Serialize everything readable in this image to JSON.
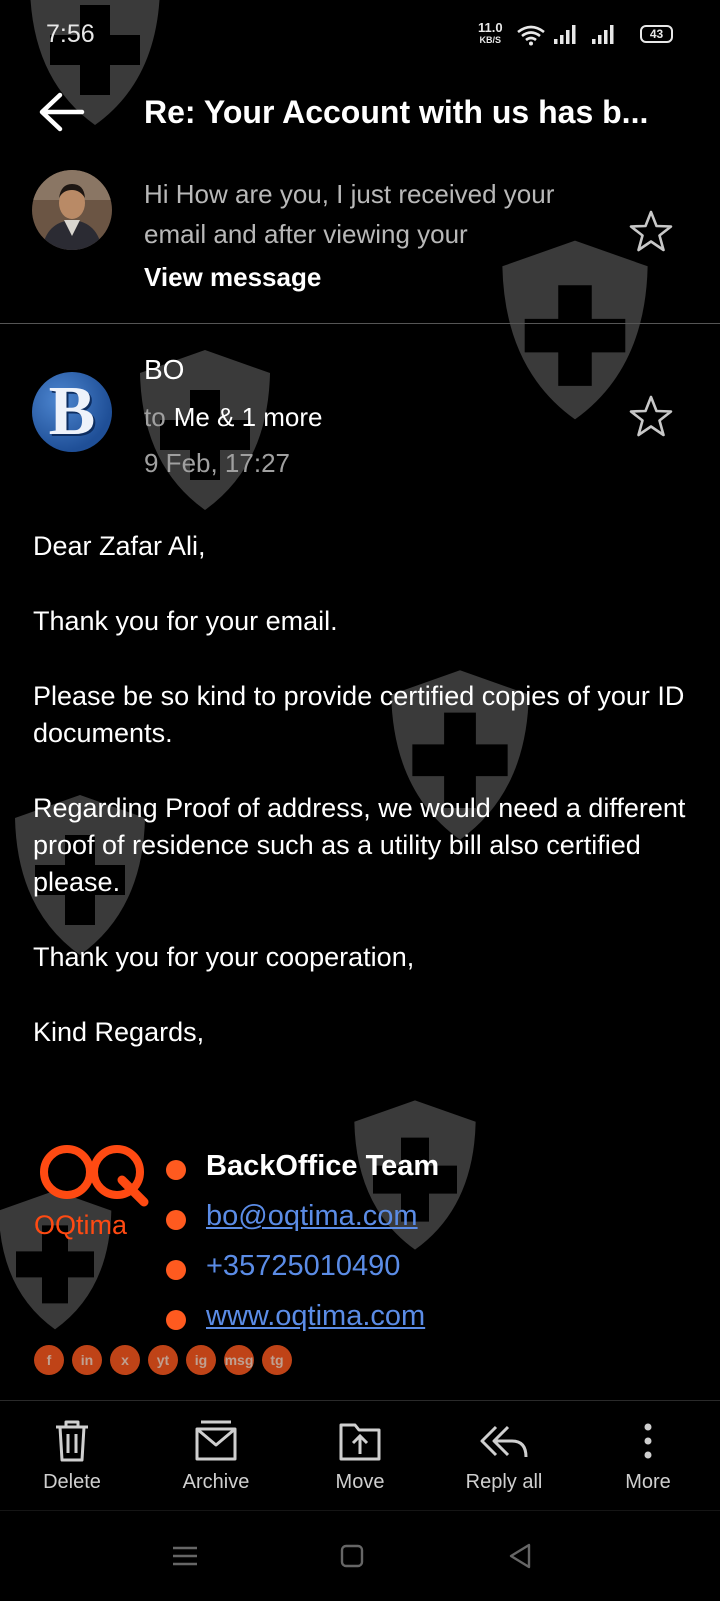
{
  "status_bar": {
    "time": "7:56",
    "net_speed_value": "11.0",
    "net_speed_unit": "KB/S",
    "battery": "43"
  },
  "header": {
    "subject": "Re: Your Account with us has b..."
  },
  "collapsed_message": {
    "preview": "Hi How are you, I just received your email and after viewing your",
    "view_message_label": "View message"
  },
  "expanded_message": {
    "avatar_letter": "B",
    "sender": "BO",
    "to_label": "to",
    "recipients": "Me & 1 more",
    "date": "9 Feb, 17:27",
    "body": [
      "Dear Zafar Ali,",
      "Thank you for your email.",
      "Please be so kind to provide certified copies of your ID documents.",
      "Regarding Proof of address,  we would need a different proof of residence such as a utility bill also certified please.",
      "Thank you for your cooperation,",
      "Kind Regards,"
    ]
  },
  "signature": {
    "logo_text": "OQtima",
    "name": "BackOffice Team",
    "email": "bo@oqtima.com",
    "phone": "+35725010490",
    "website": "www.oqtima.com",
    "social": [
      "f",
      "in",
      "x",
      "yt",
      "ig",
      "msg",
      "tg"
    ]
  },
  "toolbar": {
    "delete": "Delete",
    "archive": "Archive",
    "move": "Move",
    "reply_all": "Reply all",
    "more": "More"
  },
  "colors": {
    "background": "#000000",
    "link": "#5b8ce6",
    "brand_orange": "#ff5a1f",
    "secondary_text": "#a0a0a0"
  }
}
